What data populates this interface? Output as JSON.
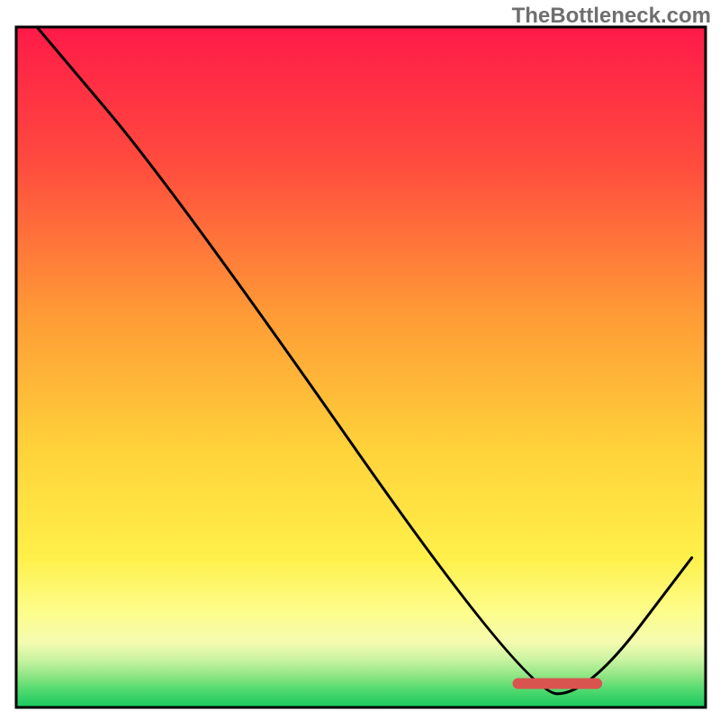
{
  "watermark": "TheBottleneck.com",
  "chart_data": {
    "type": "line",
    "title": "",
    "xlabel": "",
    "ylabel": "",
    "xlim": [
      0,
      100
    ],
    "ylim": [
      0,
      100
    ],
    "grid": false,
    "gradient_note": "Background heatmap gradient from red (top) through orange/yellow to green (bottom); readable implied value: top=high bottleneck, bottom=low bottleneck.",
    "curve": {
      "name": "bottleneck-curve",
      "x": [
        3,
        23,
        74,
        83,
        98
      ],
      "y": [
        100,
        76,
        2,
        2,
        22
      ]
    },
    "marker_bar": {
      "note": "red rounded horizontal marker near curve minimum",
      "x_start": 72,
      "x_end": 85,
      "y": 3.5,
      "color": "#d9544f"
    },
    "gradient_stops": [
      {
        "offset": 0,
        "color": "#ff1a48"
      },
      {
        "offset": 0.2,
        "color": "#ff4b3e"
      },
      {
        "offset": 0.42,
        "color": "#ff9a36"
      },
      {
        "offset": 0.62,
        "color": "#ffd23a"
      },
      {
        "offset": 0.78,
        "color": "#fff04a"
      },
      {
        "offset": 0.86,
        "color": "#fdfd8b"
      },
      {
        "offset": 0.905,
        "color": "#f4fbb0"
      },
      {
        "offset": 0.93,
        "color": "#c9f3a0"
      },
      {
        "offset": 0.955,
        "color": "#8be582"
      },
      {
        "offset": 0.975,
        "color": "#4fd96e"
      },
      {
        "offset": 1.0,
        "color": "#17c95f"
      }
    ],
    "border_color": "#000000",
    "border_width": 3
  }
}
